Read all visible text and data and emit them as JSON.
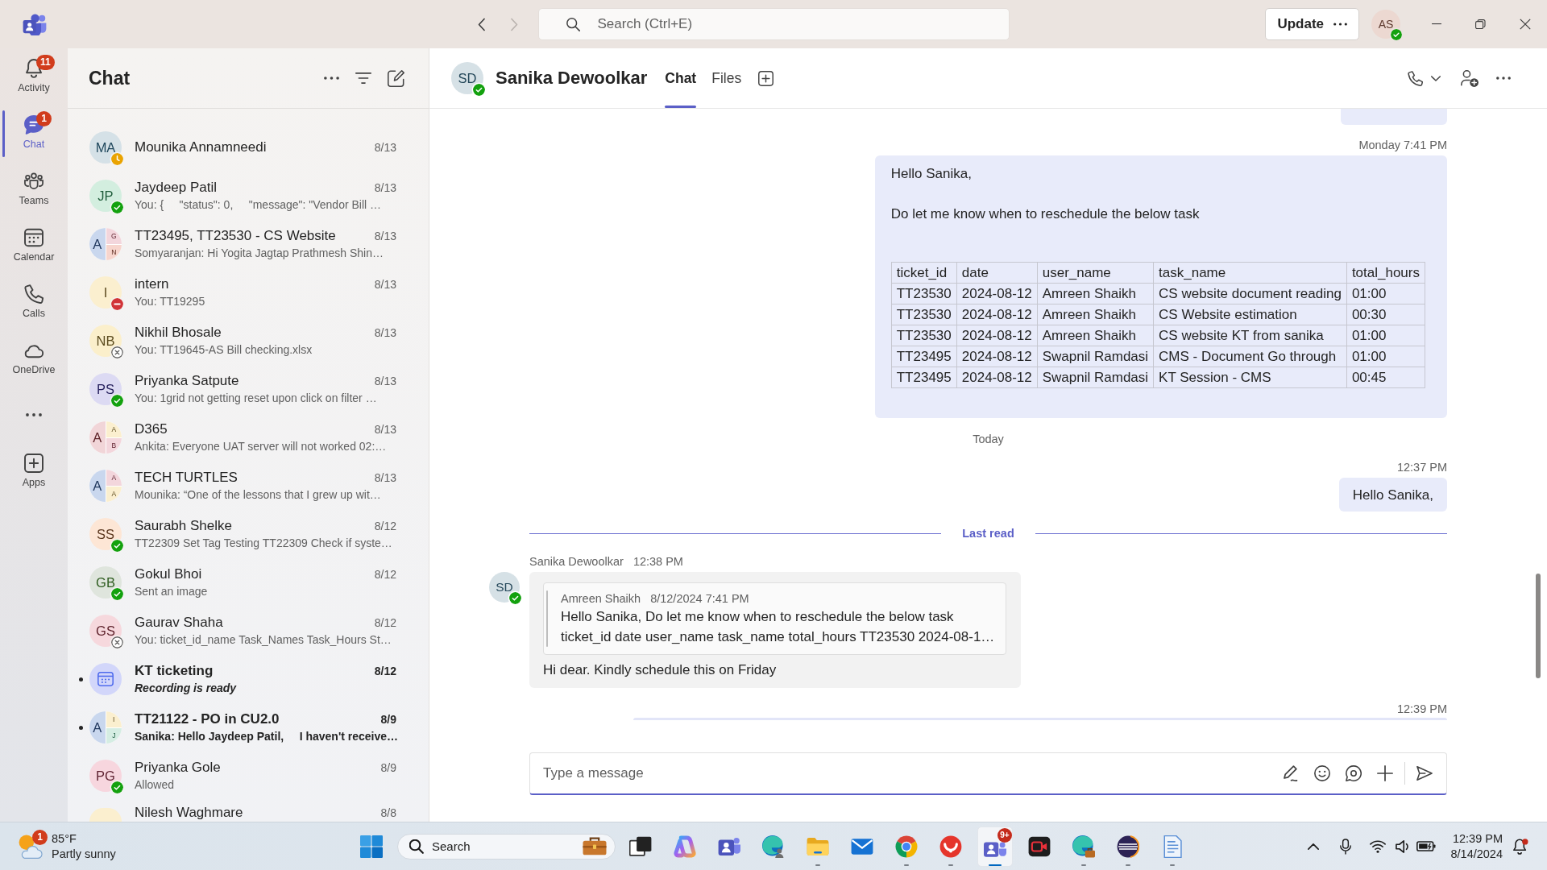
{
  "title_bar": {
    "nav_buttons": [
      {
        "disabled": false
      },
      {
        "disabled": true
      }
    ],
    "search": {
      "placeholder": "Search (Ctrl+E)"
    },
    "update_button": {
      "label": "Update"
    },
    "user": {
      "initials": "AS",
      "status": {
        "kind": "available"
      }
    }
  },
  "rail": {
    "items": [
      {
        "kind": "nav",
        "label": "Activity",
        "badge": "11",
        "selected": false
      },
      {
        "kind": "nav",
        "label": "Chat",
        "badge": "1",
        "selected": true
      },
      {
        "kind": "nav",
        "label": "Teams",
        "selected": false
      },
      {
        "kind": "nav",
        "label": "Calendar",
        "selected": false
      },
      {
        "kind": "nav",
        "label": "Calls",
        "selected": false
      },
      {
        "kind": "nav",
        "label": "OneDrive",
        "selected": false
      },
      {
        "kind": "more",
        "selected": false
      },
      {
        "kind": "nav",
        "label": "Apps",
        "selected": false
      }
    ]
  },
  "chat_list": {
    "title": "Chat",
    "last_item_cut_off": true,
    "chats": [
      {
        "kind": "person",
        "initials": "MA",
        "color": "#d5e1e7",
        "status": {
          "kind": "away"
        },
        "name": "Mounika Annamneedi",
        "date": "8/13",
        "unread": false
      },
      {
        "kind": "person",
        "initials": "JP",
        "color": "#d3eedf",
        "status": {
          "kind": "available"
        },
        "name": "Jaydeep Patil",
        "date": "8/13",
        "preview": "You: {     \"status\": 0,     \"message\": \"Vendor Bill …",
        "unread": false
      },
      {
        "kind": "group",
        "members": [
          {
            "initial": "A",
            "color": "#c9d7ee"
          },
          {
            "initial": "G",
            "color": "#f3d6dc"
          },
          {
            "initial": "N",
            "color": "#f7d5cd"
          }
        ],
        "name": "TT23495, TT23530 - CS Website",
        "date": "8/13",
        "preview": "Somyaranjan: Hi Yogita Jagtap Prathmesh Shin…",
        "unread": false
      },
      {
        "kind": "person",
        "initials": "I",
        "color": "#fbefcf",
        "status": {
          "kind": "busy"
        },
        "name": "intern",
        "date": "8/13",
        "preview": "You: TT19295",
        "unread": false
      },
      {
        "kind": "person",
        "initials": "NB",
        "color": "#fbefcb",
        "status": {
          "kind": "offline"
        },
        "name": "Nikhil Bhosale",
        "date": "8/13",
        "preview": "You: TT19645-AS Bill checking.xlsx",
        "unread": false
      },
      {
        "kind": "person",
        "initials": "PS",
        "color": "#dcdaf3",
        "status": {
          "kind": "available"
        },
        "name": "Priyanka Satpute",
        "date": "8/13",
        "preview": "You: 1grid not getting reset upon click on filter …",
        "unread": false
      },
      {
        "kind": "group",
        "members": [
          {
            "initial": "A",
            "color": "#f1d5d8"
          },
          {
            "initial": "A",
            "color": "#fbefcf"
          },
          {
            "initial": "B",
            "color": "#f3d6dc"
          }
        ],
        "name": "D365",
        "date": "8/13",
        "preview": "Ankita: Everyone UAT server will not worked 02:…",
        "unread": false
      },
      {
        "kind": "group",
        "members": [
          {
            "initial": "A",
            "color": "#c9d7ee"
          },
          {
            "initial": "A",
            "color": "#f3d6dc"
          },
          {
            "initial": "A",
            "color": "#fbefcf"
          }
        ],
        "name": "TECH TURTLES",
        "date": "8/13",
        "preview": "Mounika: “One of the lessons that I grew up wit…",
        "unread": false
      },
      {
        "kind": "person",
        "initials": "SS",
        "color": "#fde6d5",
        "status": {
          "kind": "available"
        },
        "name": "Saurabh Shelke",
        "date": "8/12",
        "preview": "TT22309 Set Tag Testing TT22309 Check if syste…",
        "unread": false
      },
      {
        "kind": "person",
        "initials": "GB",
        "color": "#dfe5dd",
        "status": {
          "kind": "available"
        },
        "name": "Gokul Bhoi",
        "date": "8/12",
        "preview": "Sent an image",
        "unread": false
      },
      {
        "kind": "person",
        "initials": "GS",
        "color": "#f6d8dd",
        "status": {
          "kind": "offline"
        },
        "name": "Gaurav Shaha",
        "date": "8/12",
        "preview": "You: ticket_id_name Task_Names Task_Hours St…",
        "unread": false
      },
      {
        "kind": "meeting",
        "color": "#d2d6fa",
        "name": "KT ticketing",
        "date": "8/12",
        "preview": "Recording is ready",
        "unread": true
      },
      {
        "kind": "group",
        "members": [
          {
            "initial": "A",
            "color": "#c9d7ee"
          },
          {
            "initial": "I",
            "color": "#fbefcf"
          },
          {
            "initial": "J",
            "color": "#d5ede3"
          }
        ],
        "name": "TT21122 - PO in CU2.0",
        "date": "8/9",
        "preview": "Sanika: Hello Jaydeep Patil,     I haven't receive…",
        "unread": true
      },
      {
        "kind": "person",
        "initials": "PG",
        "color": "#f7d6de",
        "status": {
          "kind": "available"
        },
        "name": "Priyanka Gole",
        "date": "8/9",
        "preview": "Allowed",
        "unread": false
      },
      {
        "kind": "person",
        "color": "#fbefcf",
        "name": "Nilesh Waghmare",
        "date": "8/8",
        "unread": false
      }
    ]
  },
  "conversation": {
    "contact": {
      "initials": "SD",
      "status": {
        "kind": "available"
      },
      "name": "Sanika Dewoolkar"
    },
    "tabs": [
      {
        "label": "Chat",
        "selected": true
      },
      {
        "label": "Files",
        "selected": false
      }
    ],
    "messages": [
      {
        "kind": "cut_off_bubble"
      },
      {
        "kind": "outgoing",
        "time": "Monday 7:41 PM",
        "paragraphs": [
          "Hello Sanika,",
          "Do let me know when to reschedule the below task"
        ],
        "table": {
          "columns": [
            "ticket_id",
            "date",
            "user_name",
            "task_name",
            "total_hours"
          ],
          "rows": [
            [
              "TT23530",
              "2024-08-12",
              "Amreen Shaikh",
              "CS website document reading",
              "01:00"
            ],
            [
              "TT23530",
              "2024-08-12",
              "Amreen Shaikh",
              "CS Website estimation",
              "00:30"
            ],
            [
              "TT23530",
              "2024-08-12",
              "Amreen Shaikh",
              "CS website KT from sanika",
              "01:00"
            ],
            [
              "TT23495",
              "2024-08-12",
              "Swapnil Ramdasi",
              "CMS - Document Go through",
              "01:00"
            ],
            [
              "TT23495",
              "2024-08-12",
              "Swapnil Ramdasi",
              "KT Session - CMS",
              "00:45"
            ]
          ]
        }
      },
      {
        "kind": "day_divider",
        "label": "Today"
      },
      {
        "kind": "outgoing",
        "time": "12:37 PM",
        "paragraphs": [
          "Hello Sanika,"
        ]
      },
      {
        "kind": "last_read",
        "label": "Last read"
      },
      {
        "kind": "incoming",
        "sender": "Sanika Dewoolkar",
        "time": "12:38 PM",
        "avatar": {
          "initials": "SD",
          "status": {
            "kind": "available"
          }
        },
        "quote": {
          "author": "Amreen Shaikh",
          "time": "8/12/2024 7:41 PM",
          "lines": [
            "Hello Sanika, Do let me know when to reschedule the below task",
            "ticket_id date user_name task_name total_hours TT23530 2024-08-1…"
          ]
        },
        "text": "Hi dear. Kindly schedule this on Friday"
      },
      {
        "kind": "covered_bubble",
        "time": "12:39 PM"
      }
    ],
    "composer": {
      "placeholder": "Type a message"
    }
  },
  "taskbar": {
    "weather": {
      "badge": "1",
      "temperature": "85°F",
      "condition": "Partly sunny"
    },
    "search": {
      "placeholder": "Search"
    },
    "apps": [
      {
        "running": false,
        "selected": false
      },
      {
        "running": false,
        "selected": false
      },
      {
        "running": false,
        "selected": false
      },
      {
        "running": false,
        "selected": false
      },
      {
        "running": true,
        "selected": false
      },
      {
        "running": false,
        "selected": false
      },
      {
        "running": true,
        "selected": false
      },
      {
        "running": true,
        "selected": false
      },
      {
        "running": true,
        "selected": true,
        "badge": "9+"
      },
      {
        "running": false,
        "selected": false
      },
      {
        "running": true,
        "selected": false
      },
      {
        "running": true,
        "selected": false
      },
      {
        "running": true,
        "selected": false
      }
    ],
    "clock": {
      "time": "12:39 PM",
      "date": "8/14/2024"
    }
  }
}
